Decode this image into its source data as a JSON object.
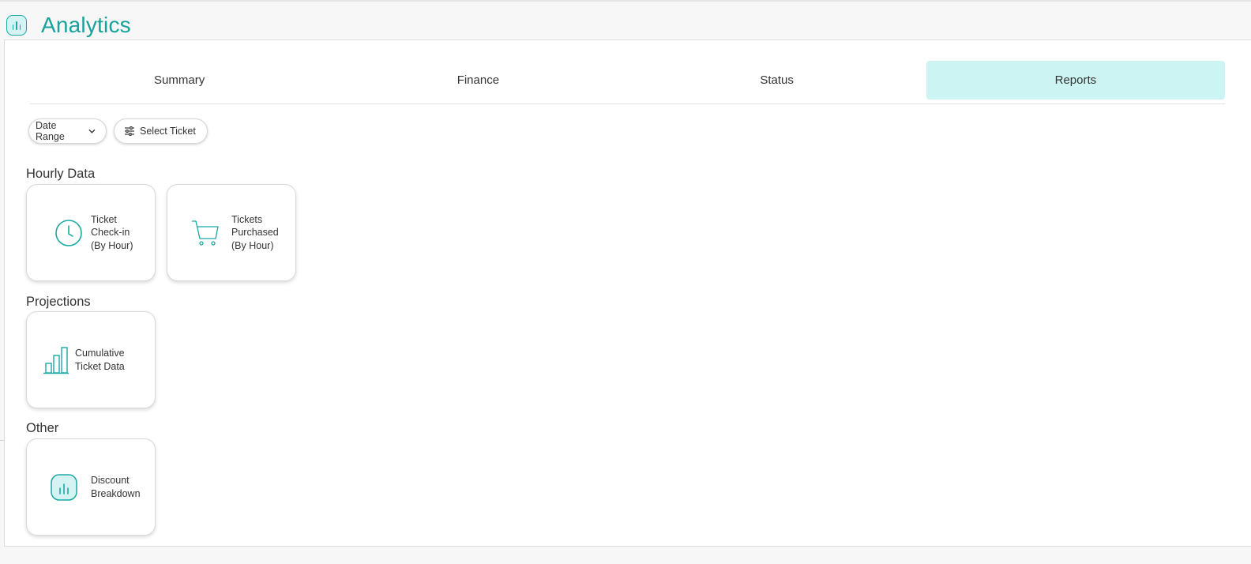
{
  "header": {
    "title": "Analytics",
    "logo_icon": "analytics-chart-icon",
    "accent_color": "#17a29c"
  },
  "tabs": [
    {
      "label": "Summary",
      "active": false
    },
    {
      "label": "Finance",
      "active": false
    },
    {
      "label": "Status",
      "active": false
    },
    {
      "label": "Reports",
      "active": true
    }
  ],
  "filters": {
    "date_range_label": "Date Range",
    "select_ticket_label": "Select Ticket"
  },
  "sections": {
    "hourly": {
      "title": "Hourly Data",
      "cards": [
        {
          "label": "Ticket Check-in (By Hour)",
          "icon": "clock-icon"
        },
        {
          "label": "Tickets Purchased (By Hour)",
          "icon": "shopping-cart-icon"
        }
      ]
    },
    "projections": {
      "title": "Projections",
      "cards": [
        {
          "label": "Cumulative Ticket Data",
          "icon": "bar-chart-icon"
        }
      ]
    },
    "other": {
      "title": "Other",
      "cards": [
        {
          "label": "Discount Breakdown",
          "icon": "analytics-chart-icon"
        }
      ]
    }
  }
}
